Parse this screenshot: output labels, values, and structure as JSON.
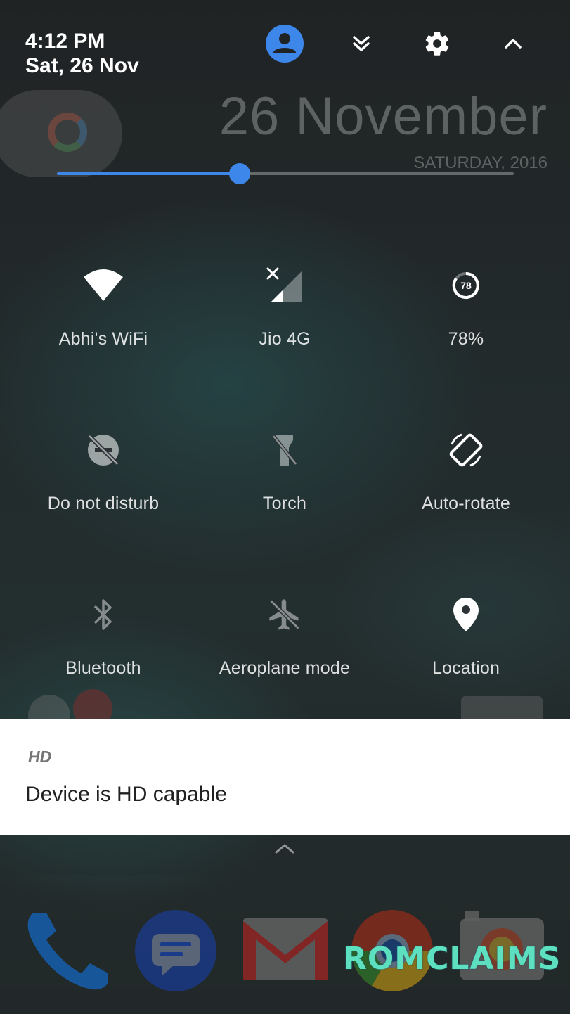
{
  "status": {
    "time": "4:12 PM",
    "date": "Sat, 26 Nov"
  },
  "header_icons": [
    "account-icon",
    "expand-notifications-icon",
    "settings-icon",
    "collapse-icon"
  ],
  "wallpaper_widget": {
    "date_big": "26 November",
    "day_year": "SATURDAY, 2016"
  },
  "brightness": {
    "level": 0.4,
    "accent": "#3d86ea"
  },
  "tiles": [
    {
      "label": "Abhi's WiFi",
      "icon": "wifi-icon",
      "active": true
    },
    {
      "label": "Jio 4G",
      "icon": "cellular-signal-icon",
      "active": true
    },
    {
      "label": "78%",
      "icon": "battery-icon",
      "active": true,
      "badge": "78"
    },
    {
      "label": "Do not disturb",
      "icon": "do-not-disturb-icon",
      "active": false
    },
    {
      "label": "Torch",
      "icon": "torch-icon",
      "active": false
    },
    {
      "label": "Auto-rotate",
      "icon": "auto-rotate-icon",
      "active": true
    },
    {
      "label": "Bluetooth",
      "icon": "bluetooth-icon",
      "active": false
    },
    {
      "label": "Aeroplane mode",
      "icon": "aeroplane-icon",
      "active": false
    },
    {
      "label": "Location",
      "icon": "location-icon",
      "active": true
    }
  ],
  "notification": {
    "app": "HD",
    "message": "Device is HD capable"
  },
  "dock": [
    "phone-icon",
    "messages-icon",
    "gmail-icon",
    "chrome-icon",
    "camera-icon"
  ],
  "watermark": "ROMCLAIMS"
}
